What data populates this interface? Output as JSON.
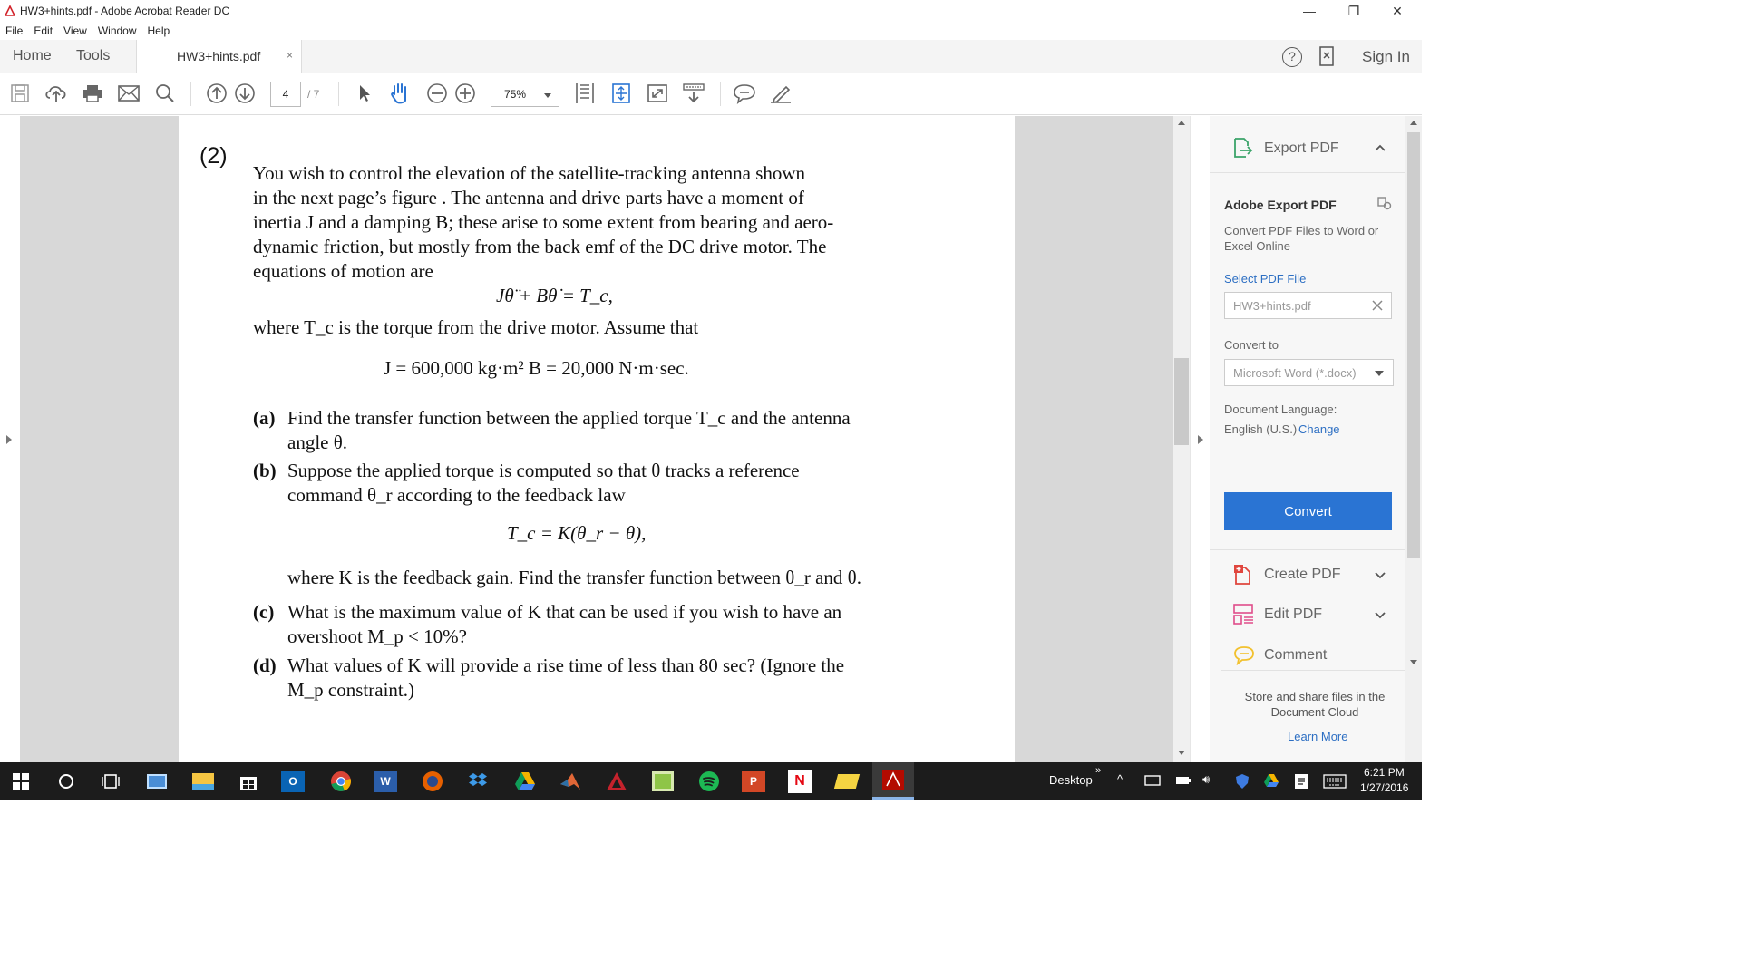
{
  "window": {
    "title": "HW3+hints.pdf - Adobe Acrobat Reader DC",
    "controls": {
      "minimize": "—",
      "restore": "❐",
      "close": "✕"
    }
  },
  "menu": [
    "File",
    "Edit",
    "View",
    "Window",
    "Help"
  ],
  "nav_tabs": {
    "home": "Home",
    "tools": "Tools"
  },
  "doc_tab": {
    "label": "HW3+hints.pdf",
    "close": "×"
  },
  "header_right": {
    "help": "?",
    "sign_in": "Sign In"
  },
  "toolbar": {
    "page_current": "4",
    "page_total": "/ 7",
    "zoom": "75%",
    "icons": [
      "save-icon",
      "cloud-upload-icon",
      "print-icon",
      "email-icon",
      "search-icon",
      "prev-page-icon",
      "next-page-icon",
      "select-cursor-icon",
      "hand-tool-icon",
      "zoom-out-icon",
      "zoom-in-icon",
      "fit-width-icon",
      "fit-page-icon",
      "fullscreen-icon",
      "scroll-mode-icon",
      "comment-icon",
      "sign-icon"
    ]
  },
  "document": {
    "problem_number": "(2)",
    "intro_lines": [
      "You wish to control the elevation of the satellite-tracking antenna shown",
      "in the next page’s figure  . The antenna and drive parts have a moment of",
      "inertia J and a damping B; these arise to some extent from bearing and aero-",
      "dynamic friction, but mostly from the back emf of the DC drive motor. The",
      "equations of motion are"
    ],
    "eq1": "Jθ̈ + Bθ̇ = T_c,",
    "where_tc": "where T_c is the torque from the drive motor. Assume that",
    "eq2": "J = 600,000 kg·m²    B = 20,000 N·m·sec.",
    "part_a": {
      "label": "(a)",
      "lines": [
        "Find the transfer function between the applied torque T_c and the antenna",
        "angle θ."
      ]
    },
    "part_b": {
      "label": "(b)",
      "lines": [
        "Suppose the applied torque is computed so that θ tracks a reference",
        "command θ_r according to the feedback law"
      ]
    },
    "eq3": "T_c = K(θ_r − θ),",
    "where_k": "where K is the feedback gain. Find the transfer function between θ_r and θ.",
    "part_c": {
      "label": "(c)",
      "lines": [
        "What is the maximum value of K that can be used if you wish to have an",
        "overshoot M_p < 10%?"
      ]
    },
    "part_d": {
      "label": "(d)",
      "lines": [
        "What values of K will provide a rise time of less than 80 sec? (Ignore the",
        "M_p constraint.)"
      ]
    }
  },
  "right_pane": {
    "export_header": "Export PDF",
    "section_title": "Adobe Export PDF",
    "description": "Convert PDF Files to Word or Excel Online",
    "select_file": "Select PDF File",
    "file_name": "HW3+hints.pdf",
    "convert_to_label": "Convert to",
    "convert_to_value": "Microsoft Word (*.docx)",
    "doc_lang_label": "Document Language:",
    "doc_lang_value": "English (U.S.)",
    "change": "Change",
    "convert_button": "Convert",
    "tools": [
      {
        "label": "Create PDF",
        "color": "#e0463e"
      },
      {
        "label": "Edit PDF",
        "color": "#e04d8a"
      },
      {
        "label": "Comment",
        "color": "#f2c12e"
      }
    ],
    "cloud_text": "Store and share files in the Document Cloud",
    "learn_more": "Learn More"
  },
  "taskbar": {
    "desktop_label": "Desktop",
    "time": "6:21 PM",
    "date": "1/27/2016",
    "apps": [
      "windows-start",
      "cortana",
      "task-view",
      "control-panel",
      "file-explorer",
      "store",
      "outlook",
      "chrome",
      "word",
      "firefox",
      "dropbox",
      "google-drive",
      "matlab",
      "autocad",
      "camtasia",
      "spotify",
      "powerpoint",
      "netflix",
      "folder",
      "acrobat"
    ]
  }
}
